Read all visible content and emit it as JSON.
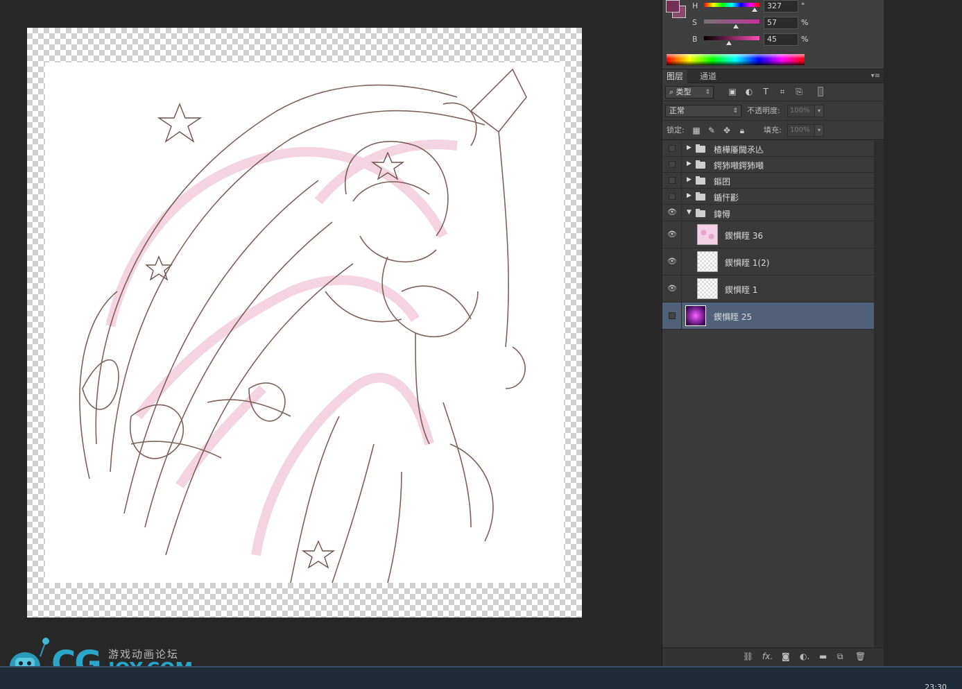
{
  "color_panel": {
    "h_label": "H",
    "h_value": "327",
    "h_unit": "°",
    "s_label": "S",
    "s_value": "57",
    "s_unit": "%",
    "b_label": "B",
    "b_value": "45",
    "b_unit": "%",
    "foreground_color": "#732F55",
    "h_fraction": 0.908,
    "s_fraction": 0.57,
    "b_fraction": 0.45
  },
  "layers_panel": {
    "tabs": [
      "图层",
      "通道"
    ],
    "filter_label": "类型",
    "blend_mode": "正常",
    "opacity_label": "不透明度:",
    "opacity_value": "100%",
    "lock_label": "锁定:",
    "fill_label": "填充:",
    "fill_value": "100%",
    "layers": [
      {
        "name": "楂樺厜閫氶亾",
        "type": "group",
        "visible": false,
        "expanded": false
      },
      {
        "name": "鍔犻噸鍔犻噸",
        "type": "group",
        "visible": false,
        "expanded": false
      },
      {
        "name": "鏂囨",
        "type": "group",
        "visible": false,
        "expanded": false
      },
      {
        "name": "鍎忓彲",
        "type": "group",
        "visible": false,
        "expanded": false
      },
      {
        "name": "鍏憳",
        "type": "group",
        "visible": true,
        "expanded": true
      },
      {
        "name": "鍥惧眰 36",
        "type": "layer",
        "visible": true
      },
      {
        "name": "鍥惧眰 1(2)",
        "type": "layer",
        "visible": true
      },
      {
        "name": "鍥惧眰 1",
        "type": "layer",
        "visible": true
      },
      {
        "name": "鍥惧眰 25",
        "type": "layer",
        "visible": false,
        "selected": true
      }
    ]
  },
  "watermark": {
    "cg": "CG",
    "forum": "游戏动画论坛",
    "joy": "JOY.COM"
  },
  "taskbar": {
    "clock": "23:30"
  }
}
